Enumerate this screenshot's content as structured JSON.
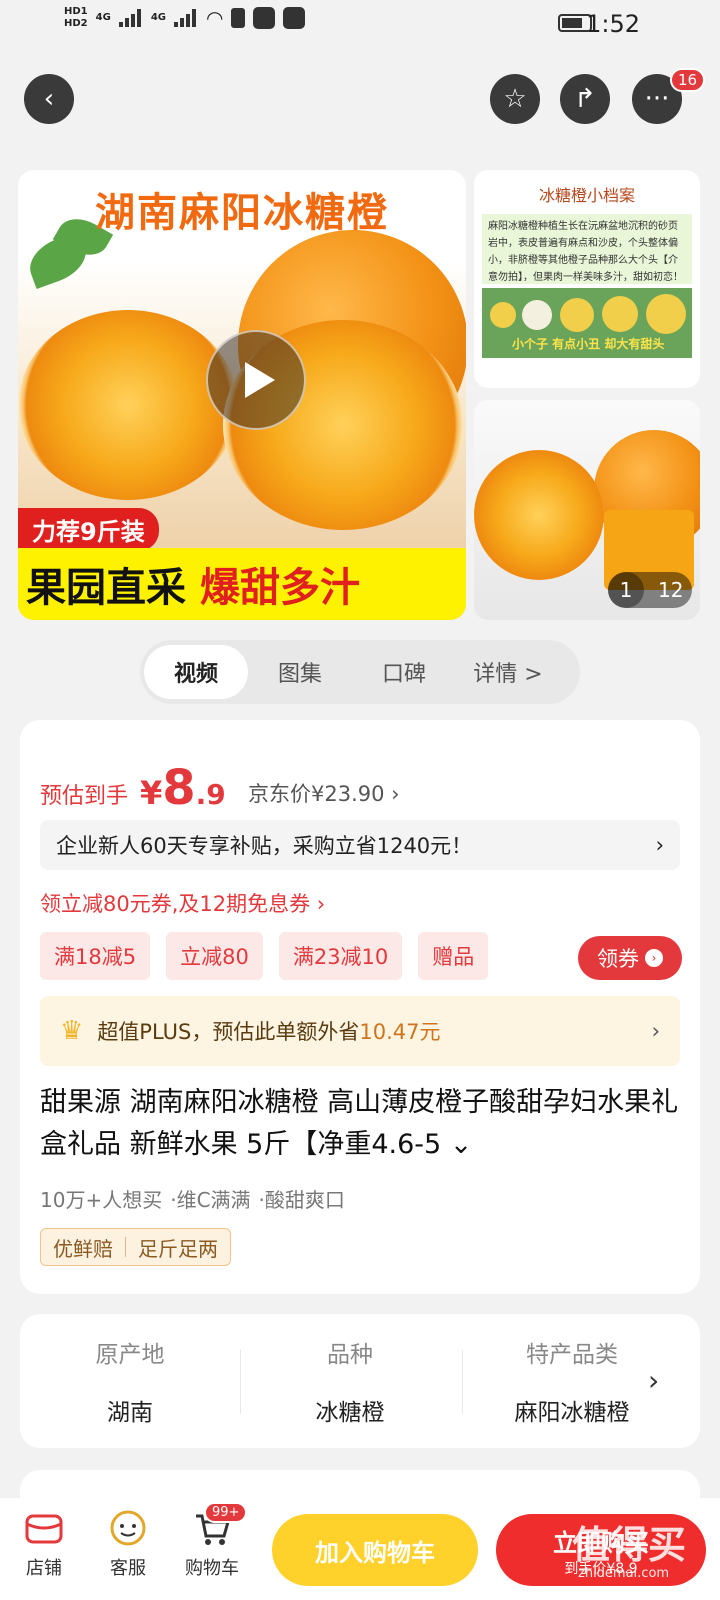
{
  "status_bar": {
    "time": "1:52",
    "hd1": "HD1",
    "hd2": "HD2",
    "net1": "4G",
    "net2": "4G"
  },
  "nav": {
    "more_badge": "16",
    "back_icon": "chevron-left-icon",
    "fav_icon": "star-icon",
    "share_icon": "share-icon",
    "more_icon": "more-icon"
  },
  "gallery": {
    "main_title": "湖南麻阳冰糖橙",
    "tag": "力荐9斤装",
    "banner_left": "果园直采",
    "banner_right": "爆甜多汁",
    "side_title": "冰糖橙小档案",
    "side_text": "麻阳冰糖橙种植生长在沅麻盆地沉积的砂页岩中，表皮普遍有麻点和沙皮，个头整体偏小，非脐橙等其他橙子品种那么大个头【介意勿拍】，但果肉一样美味多汁，甜如初恋！",
    "side_caption": "小个子 有点小丑 却大有甜头",
    "pager_current": "1",
    "pager_total": "12"
  },
  "tabs": [
    {
      "label": "视频",
      "active": true
    },
    {
      "label": "图集",
      "active": false
    },
    {
      "label": "口碑",
      "active": false
    },
    {
      "label": "详情 >",
      "active": false
    }
  ],
  "price": {
    "label": "预估到手",
    "symbol": "¥",
    "integer": "8",
    "decimal": ".9",
    "jd_price": "京东价¥23.90 ›"
  },
  "subsidy": {
    "text": "企业新人60天专享补贴，采购立省1240元！",
    "arrow": "›"
  },
  "coupon_line": "领立减80元券,及12期免息券 ›",
  "chips": [
    "满18减5",
    "立减80",
    "满23减10",
    "赠品"
  ],
  "get_coupon": "领券",
  "plus": {
    "prefix": "超值PLUS，预估此单额外省",
    "amount": "10.47元",
    "arrow": "›"
  },
  "product_title": "甜果源 湖南麻阳冰糖橙 高山薄皮橙子酸甜孕妇水果礼盒礼品 新鲜水果 5斤【净重4.6-5 ⌄",
  "meta": [
    "10万+人想买",
    "·维C满满",
    "·酸甜爽口"
  ],
  "guarantee": [
    "优鲜赔",
    "足斤足两"
  ],
  "attributes": [
    {
      "key": "原产地",
      "value": "湖南"
    },
    {
      "key": "品种",
      "value": "冰糖橙"
    },
    {
      "key": "特产品类",
      "value": "麻阳冰糖橙"
    }
  ],
  "attributes_arrow": "›",
  "bottom": {
    "store": "店铺",
    "service": "客服",
    "cart": "购物车",
    "cart_badge": "99+",
    "add_cart": "加入购物车",
    "buy_now": "立即购买",
    "buy_sub": "到手价¥8.9"
  },
  "watermark": {
    "main": "值得买",
    "sub": "zhidemai.com"
  },
  "colors": {
    "accent_red": "#e4393c",
    "cart_yellow": "#ffd12a",
    "buy_red": "#f02d2d"
  }
}
